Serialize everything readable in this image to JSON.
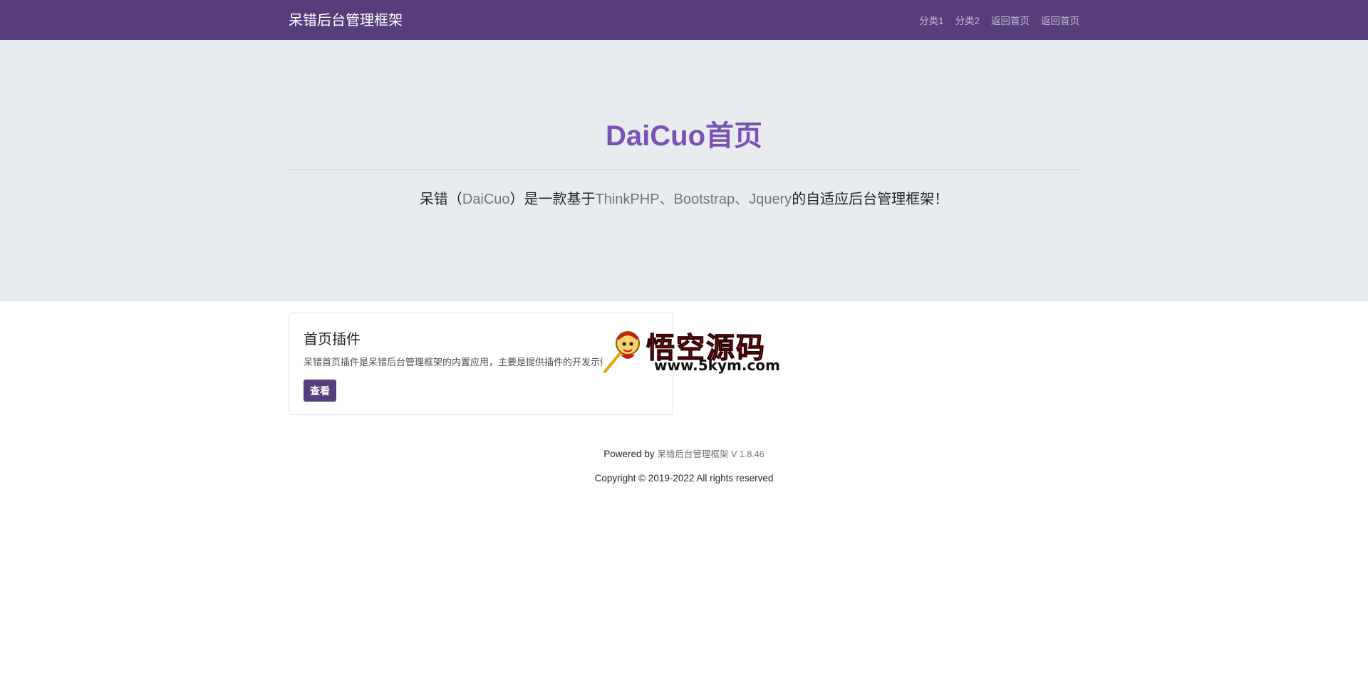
{
  "navbar": {
    "brand": "呆错后台管理框架",
    "links": [
      "分类1",
      "分类2",
      "返回首页",
      "返回首页"
    ]
  },
  "hero": {
    "title": "DaiCuo首页",
    "lead": {
      "p1": "呆错（",
      "p2": "DaiCuo",
      "p3": "）是一款基于",
      "p4": "ThinkPHP、Bootstrap、Jquery",
      "p5": "的自适应后台管理框架！"
    }
  },
  "card": {
    "title": "首页插件",
    "text": "呆错首页插件是呆错后台管理框架的内置应用，主要是提供插件的开发示例。",
    "button_label": "查看"
  },
  "watermark": {
    "title": "悟空源码",
    "url": "www.5kym.com"
  },
  "footer": {
    "powered_prefix": "Powered by",
    "powered_link": "呆错后台管理框架",
    "version": "V 1.8.46",
    "copyright": "Copyright © 2019-2022 All rights reserved"
  },
  "colors": {
    "navbar_bg": "#563d7c",
    "accent": "#7952b3",
    "jumbotron_bg": "#e9ecef"
  }
}
